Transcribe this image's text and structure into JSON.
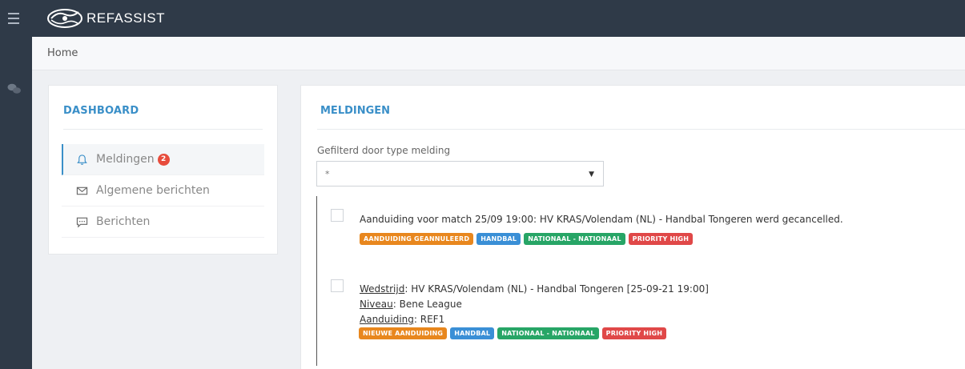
{
  "app": {
    "logo_text": "REFASSIST"
  },
  "breadcrumb": {
    "home": "Home"
  },
  "dashboard": {
    "title": "DASHBOARD",
    "items": [
      {
        "label": "Meldingen",
        "icon": "bell-icon",
        "badge": "2",
        "active": true
      },
      {
        "label": "Algemene berichten",
        "icon": "envelope-icon"
      },
      {
        "label": "Berichten",
        "icon": "message-icon"
      }
    ]
  },
  "meldingen": {
    "title": "MELDINGEN",
    "filter_label": "Gefilterd door type melding",
    "filter_value": "*",
    "notifications": [
      {
        "text": "Aanduiding voor match 25/09 19:00: HV KRAS/Volendam (NL) - Handbal Tongeren werd gecancelled.",
        "tags": [
          {
            "label": "AANDUIDING GEANNULEERD",
            "color": "#e8871e"
          },
          {
            "label": "HANDBAL",
            "color": "#3a8fd6"
          },
          {
            "label": "NATIONAAL - NATIONAAL",
            "color": "#27a566"
          },
          {
            "label": "PRIORITY HIGH",
            "color": "#e04848"
          }
        ]
      },
      {
        "wedstrijd_label": "Wedstrijd",
        "wedstrijd_value": ": HV KRAS/Volendam (NL) - Handbal Tongeren [25-09-21 19:00]",
        "niveau_label": "Niveau",
        "niveau_value": ": Bene League",
        "aanduiding_label": "Aanduiding",
        "aanduiding_value": ": REF1",
        "tags": [
          {
            "label": "NIEUWE AANDUIDING",
            "color": "#e8871e"
          },
          {
            "label": "HANDBAL",
            "color": "#3a8fd6"
          },
          {
            "label": "NATIONAAL - NATIONAAL",
            "color": "#27a566"
          },
          {
            "label": "PRIORITY HIGH",
            "color": "#e04848"
          }
        ]
      }
    ]
  }
}
